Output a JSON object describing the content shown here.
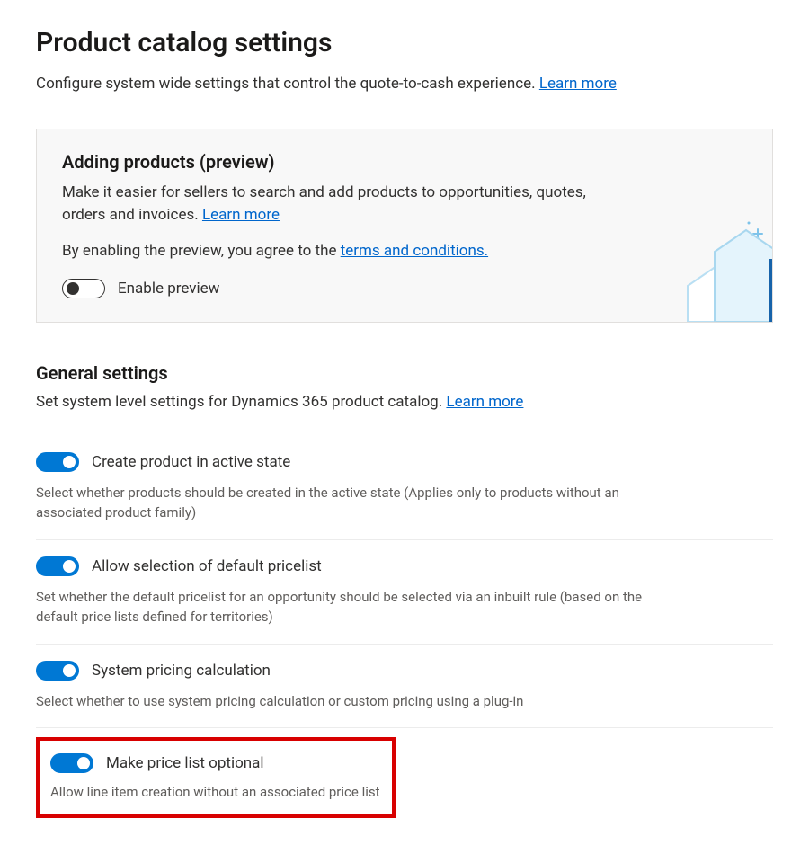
{
  "header": {
    "title": "Product catalog settings",
    "subtitle": "Configure system wide settings that control the quote-to-cash experience. ",
    "learn_more": "Learn more"
  },
  "preview_panel": {
    "title": "Adding products (preview)",
    "desc1": "Make it easier for sellers to search and add products to opportunities, quotes, orders and invoices. ",
    "learn_more": "Learn more",
    "desc2_prefix": "By enabling the preview, you agree to the ",
    "terms_link": "terms and conditions.",
    "toggle_label": "Enable preview"
  },
  "general": {
    "title": "General settings",
    "desc": "Set system level settings for Dynamics 365 product catalog. ",
    "learn_more": "Learn more",
    "settings": [
      {
        "label": "Create product in active state",
        "help": "Select whether products should be created in the active state (Applies only to products without an associated product family)",
        "on": true
      },
      {
        "label": "Allow selection of default pricelist",
        "help": "Set whether the default pricelist for an opportunity should be selected via an inbuilt rule (based on the default price lists defined for territories)",
        "on": true
      },
      {
        "label": "System pricing calculation",
        "help": "Select whether to use system pricing calculation or custom pricing using a plug-in",
        "on": true
      },
      {
        "label": "Make price list optional",
        "help": "Allow line item creation without an associated price list",
        "on": true
      }
    ]
  }
}
